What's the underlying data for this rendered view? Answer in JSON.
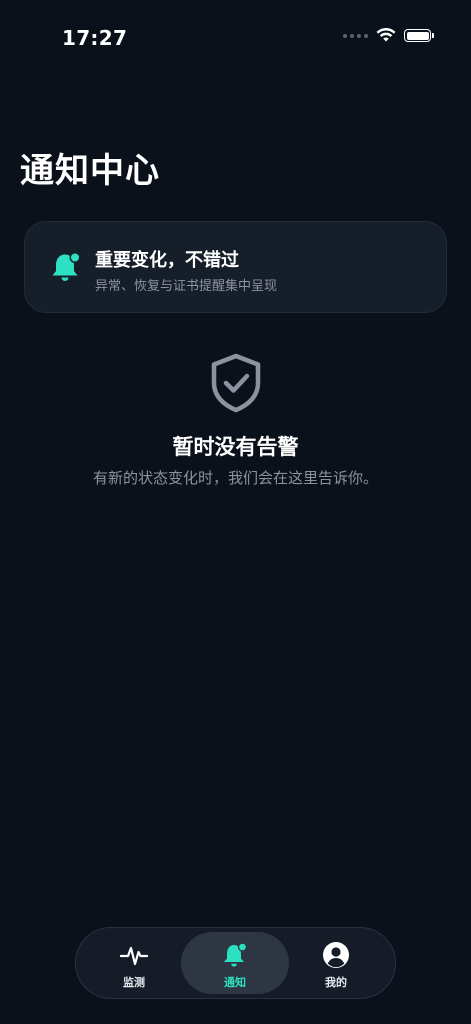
{
  "status_bar": {
    "time": "17:27"
  },
  "page": {
    "title": "通知中心"
  },
  "banner": {
    "icon": "bell-icon",
    "title": "重要变化，不错过",
    "subtitle": "异常、恢复与证书提醒集中呈现"
  },
  "empty_state": {
    "icon": "shield-check-icon",
    "title": "暂时没有告警",
    "subtitle": "有新的状态变化时，我们会在这里告诉你。"
  },
  "tab_bar": {
    "tabs": [
      {
        "label": "监测",
        "icon": "pulse-icon",
        "active": false
      },
      {
        "label": "通知",
        "icon": "bell-icon",
        "active": true
      },
      {
        "label": "我的",
        "icon": "user-icon",
        "active": false
      }
    ]
  },
  "colors": {
    "background": "#0b111b",
    "card": "#161e29",
    "accent": "#2de0c2",
    "muted_text": "#8c939e"
  }
}
